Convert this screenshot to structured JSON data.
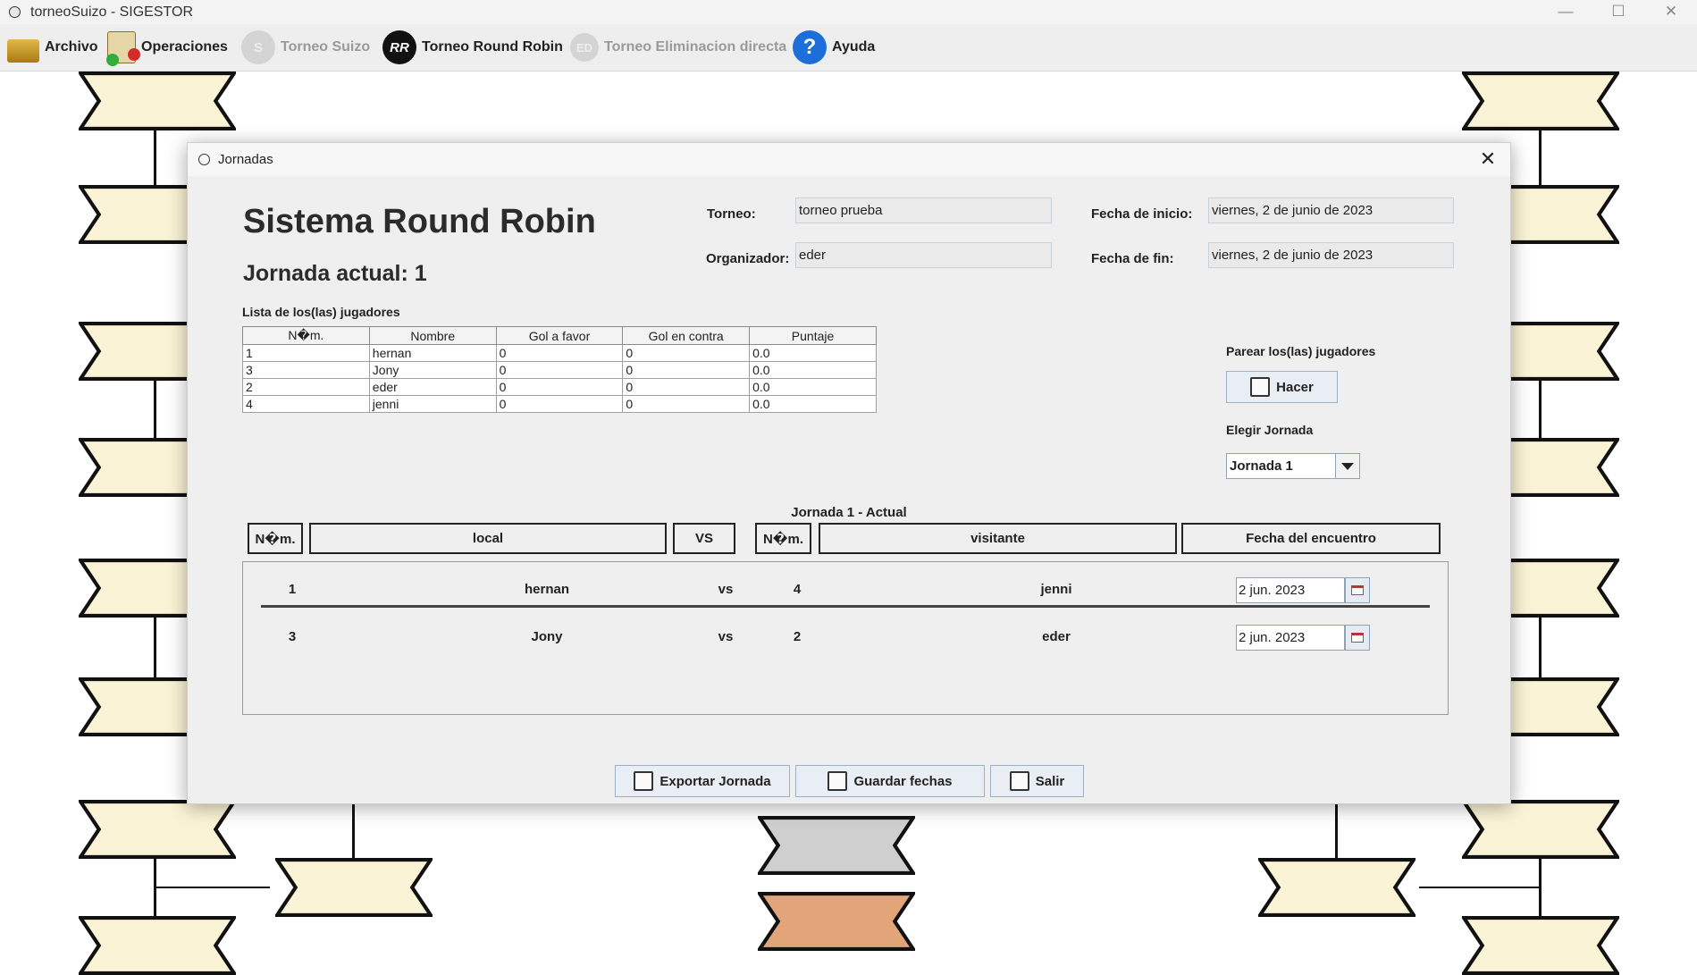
{
  "app": {
    "title": "torneoSuizo - SIGESTOR",
    "minimize": "—",
    "maximize": "☐",
    "close": "✕"
  },
  "menubar": {
    "items": [
      {
        "id": "archivo",
        "label": "Archivo",
        "enabled": true
      },
      {
        "id": "operaciones",
        "label": "Operaciones",
        "enabled": true
      },
      {
        "id": "torneo-suizo",
        "label": "Torneo Suizo",
        "icon_text": "S",
        "enabled": false
      },
      {
        "id": "torneo-round-robin",
        "label": "Torneo Round Robin",
        "icon_text": "RR",
        "enabled": true
      },
      {
        "id": "torneo-eliminacion",
        "label": "Torneo Eliminacion directa",
        "icon_text": "ED",
        "enabled": false
      },
      {
        "id": "ayuda",
        "label": "Ayuda",
        "icon_text": "?",
        "enabled": true
      }
    ]
  },
  "dialog": {
    "title": "Jornadas",
    "close": "✕",
    "heading": "Sistema Round Robin",
    "current_round": "Jornada actual: 1",
    "torneo_label": "Torneo:",
    "torneo_value": "torneo prueba",
    "organizador_label": "Organizador:",
    "organizador_value": "eder",
    "inicio_label": "Fecha de inicio:",
    "inicio_value": "viernes, 2 de junio de 2023",
    "fin_label": "Fecha de fin:",
    "fin_value": "viernes, 2 de junio de 2023",
    "players_title": "Lista de los(las) jugadores",
    "players_columns": [
      "N�m.",
      "Nombre",
      "Gol a favor",
      "Gol en contra",
      "Puntaje"
    ],
    "players": [
      [
        "1",
        "hernan",
        "0",
        "0",
        "0.0"
      ],
      [
        "3",
        "Jony",
        "0",
        "0",
        "0.0"
      ],
      [
        "2",
        "eder",
        "0",
        "0",
        "0.0"
      ],
      [
        "4",
        "jenni",
        "0",
        "0",
        "0.0"
      ]
    ],
    "pair_label": "Parear los(las) jugadores",
    "pair_button": "Hacer",
    "choose_round_label": "Elegir Jornada",
    "round_selected": "Jornada 1",
    "round_section_title": "Jornada 1 - Actual",
    "match_columns": [
      "N�m.",
      "local",
      "VS",
      "N�m.",
      "visitante",
      "Fecha del encuentro"
    ],
    "matches": [
      {
        "num_local": "1",
        "local": "hernan",
        "vs": "vs",
        "num_visit": "4",
        "visitante": "jenni",
        "fecha": "2 jun. 2023"
      },
      {
        "num_local": "3",
        "local": "Jony",
        "vs": "vs",
        "num_visit": "2",
        "visitante": "eder",
        "fecha": "2 jun. 2023"
      }
    ],
    "export_button": "Exportar Jornada",
    "save_button": "Guardar fechas",
    "exit_button": "Salir"
  },
  "colors": {
    "ribbon_fill": "#fbf3d5",
    "ribbon_grey": "#cfcfcf",
    "ribbon_orange": "#e2a57a",
    "accent_blue": "#1c6fd9"
  }
}
